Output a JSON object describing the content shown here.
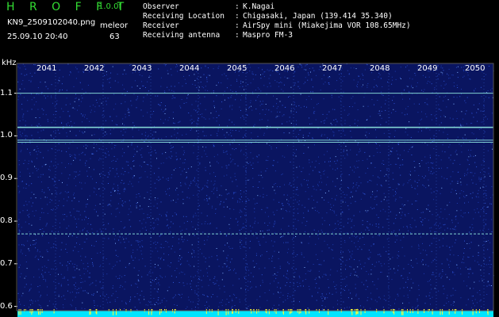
{
  "header": {
    "title": "H R O F F T",
    "version": "1.0.0f",
    "filename": "KN9_2509102040.png",
    "meleor_label": "meleor",
    "datetime": "25.09.10 20:40",
    "meteor_count": "63"
  },
  "info": [
    {
      "label": "Observer",
      "value": "K.Nagai"
    },
    {
      "label": "Receiving Location",
      "value": "Chigasaki, Japan (139.414 35.340)"
    },
    {
      "label": "Receiver",
      "value": "AirSpy mini (Miakejima VOR 108.65MHz)"
    },
    {
      "label": "Receiving antenna",
      "value": "Maspro FM-3"
    }
  ],
  "chart_data": {
    "type": "heatmap",
    "y_unit_label": "kHz",
    "x_ticks": [
      "2041",
      "2042",
      "2043",
      "2044",
      "2045",
      "2046",
      "2047",
      "2048",
      "2049",
      "2050"
    ],
    "y_ticks": [
      "1.1",
      "1.0",
      "0.9",
      "0.8",
      "0.7",
      "0.6"
    ],
    "ylim": [
      0.59,
      1.17
    ],
    "xlim": [
      "2040",
      "2050"
    ],
    "grid": true,
    "colors": {
      "background": "#0a1560",
      "noise_dots": "#2f56d8",
      "carrier_line": "#8fe8e0",
      "bottom_bar": "#00e5ff",
      "meteor_ticks": "#ffff33"
    },
    "persistent_lines_khz": [
      1.1,
      1.02,
      0.99,
      0.985,
      0.77
    ]
  }
}
